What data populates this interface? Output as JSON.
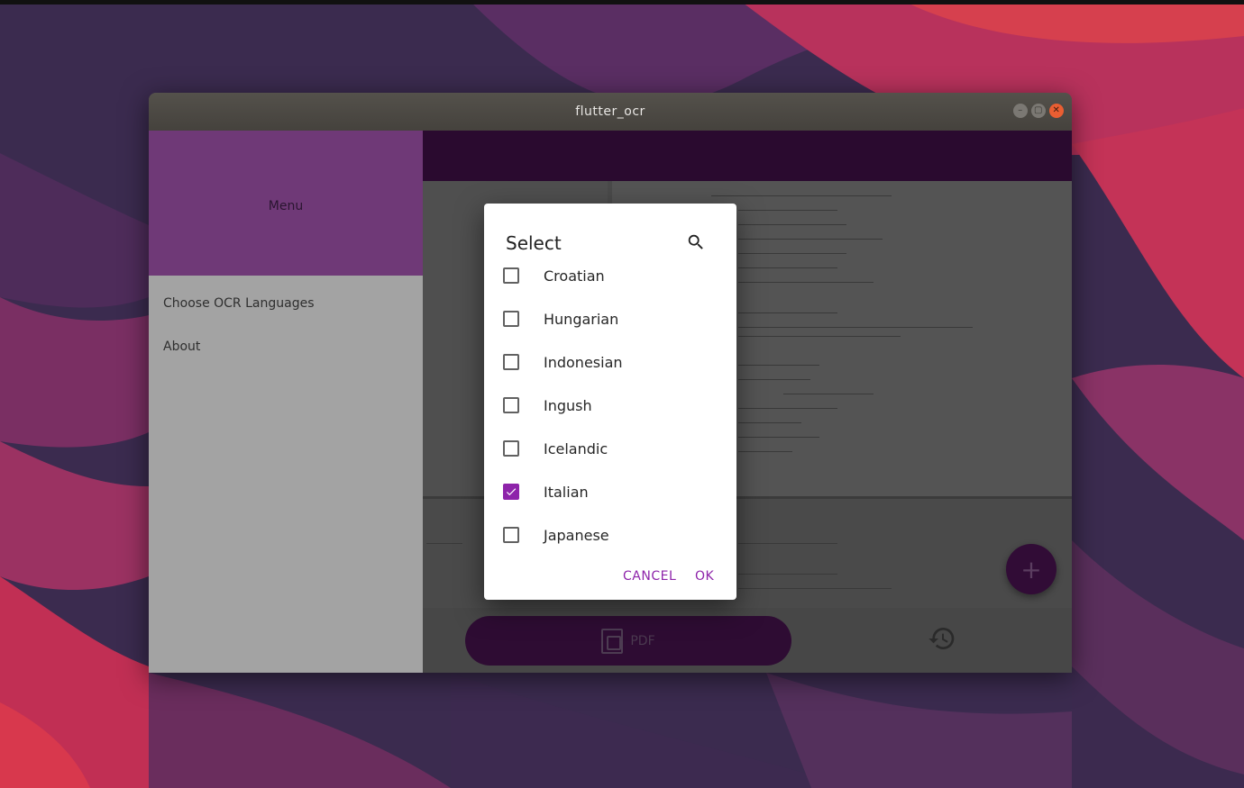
{
  "window": {
    "title": "flutter_ocr",
    "controls": [
      "minimize-icon",
      "maximize-icon",
      "close-icon"
    ]
  },
  "drawer": {
    "header_title": "Menu",
    "items": [
      {
        "label": "Choose OCR Languages"
      },
      {
        "label": "About"
      }
    ]
  },
  "bottom_bar": {
    "pdf_label": "PDF",
    "pdf_icon": "pdf-icon",
    "history_icon": "history-icon"
  },
  "fab": {
    "icon": "plus-icon",
    "glyph": "+"
  },
  "dialog": {
    "title": "Select",
    "search_icon": "search-icon",
    "options": [
      {
        "label": "Croatian",
        "checked": false
      },
      {
        "label": "Hungarian",
        "checked": false
      },
      {
        "label": "Indonesian",
        "checked": false
      },
      {
        "label": "Ingush",
        "checked": false
      },
      {
        "label": "Icelandic",
        "checked": false
      },
      {
        "label": "Italian",
        "checked": true
      },
      {
        "label": "Japanese",
        "checked": false
      }
    ],
    "cancel_label": "CANCEL",
    "ok_label": "OK"
  },
  "colors": {
    "accent": "#8e24aa",
    "drawer_header": "#6f3977",
    "app_bar": "#2a0a2f",
    "titlebar_close": "#e95e32"
  }
}
